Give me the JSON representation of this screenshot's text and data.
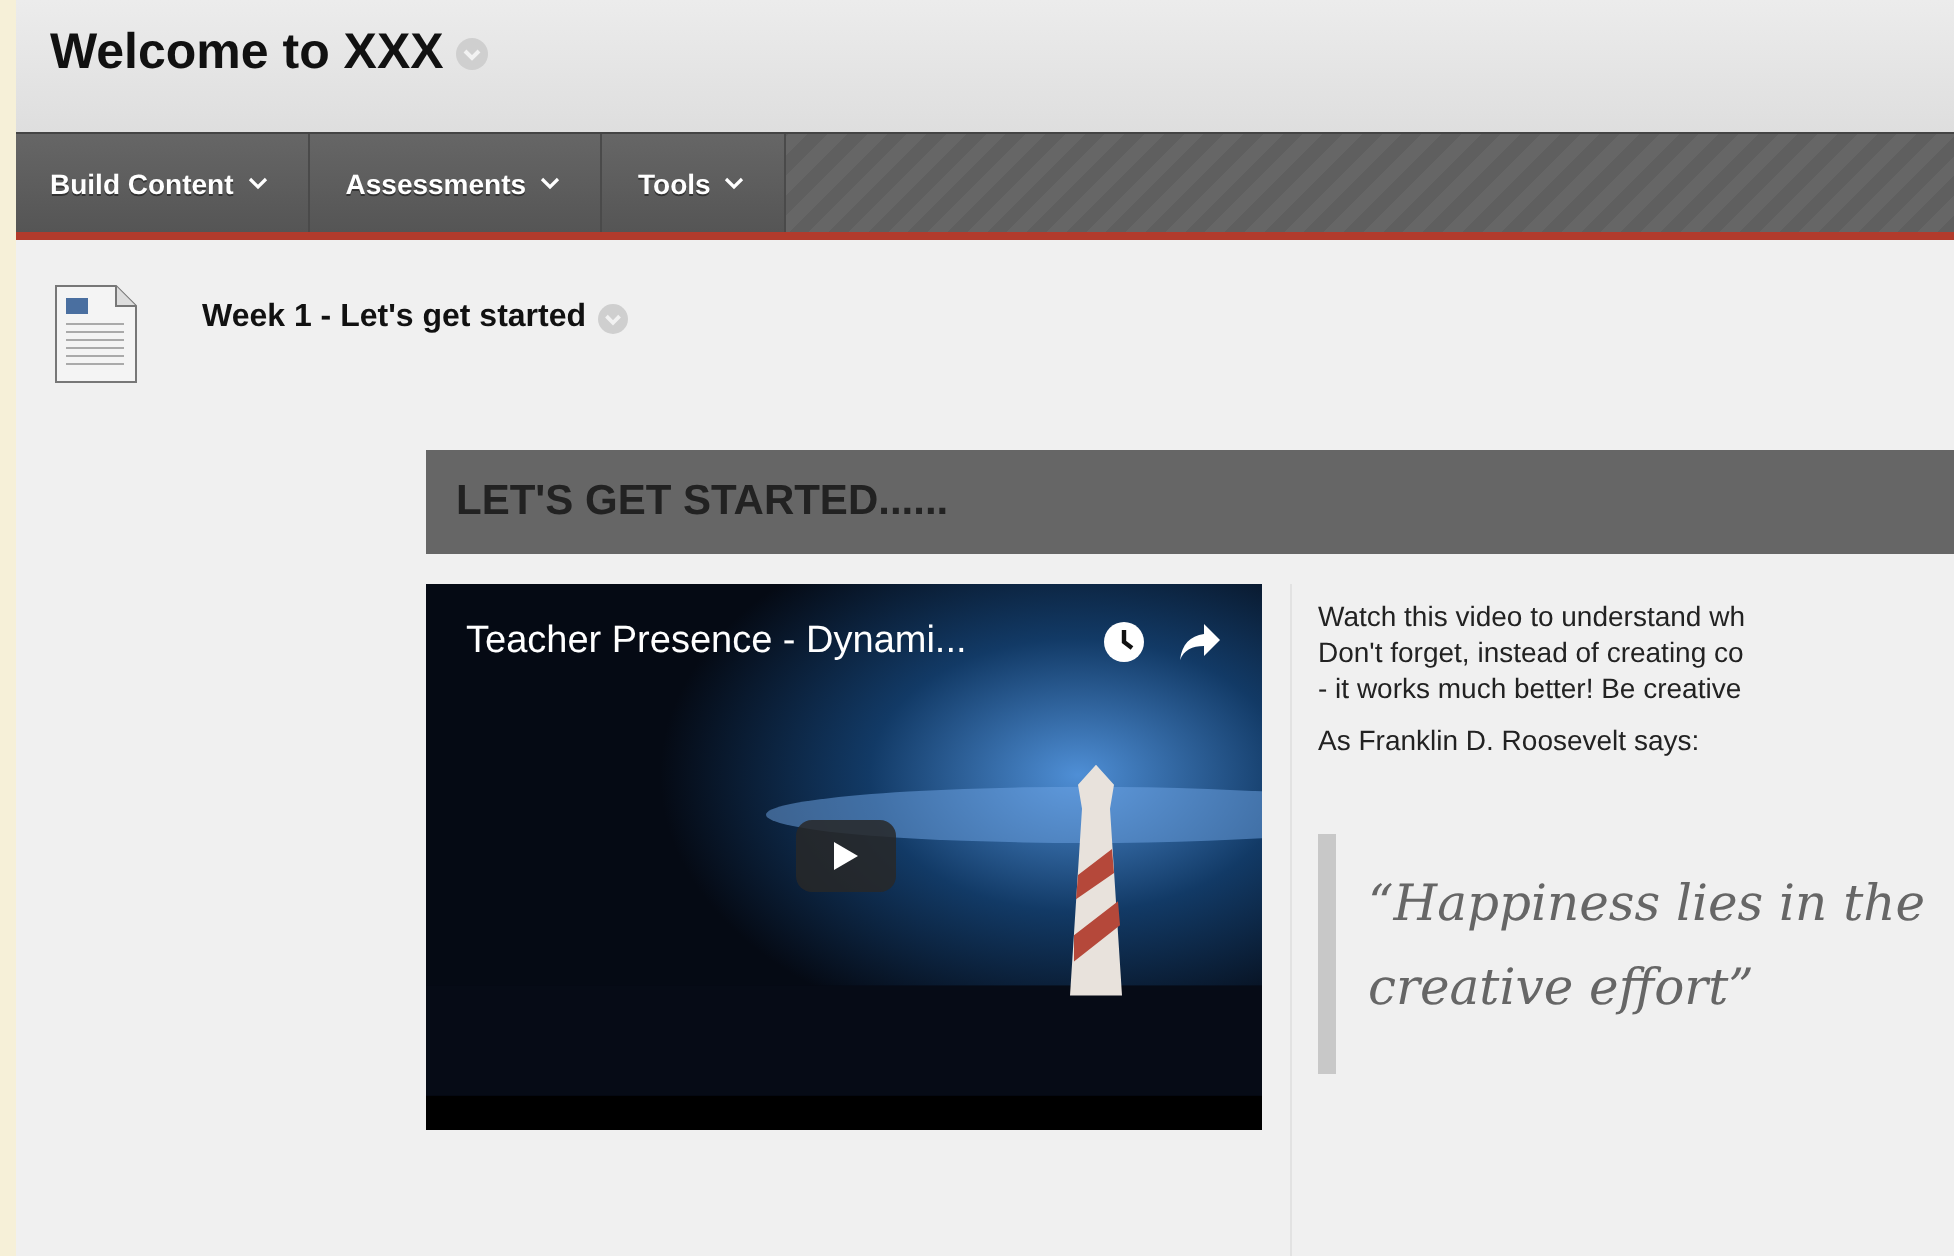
{
  "page_title": "Welcome to XXX",
  "menu": [
    {
      "label": "Build Content"
    },
    {
      "label": "Assessments"
    },
    {
      "label": "Tools"
    }
  ],
  "item": {
    "title": "Week 1 - Let's get started"
  },
  "banner": "LET'S GET STARTED......",
  "video": {
    "title": "Teacher Presence - Dynami...",
    "kind": "picture"
  },
  "paragraphs": [
    "Watch this video to understand wh\nDon't forget, instead of creating co\n- it works much better! Be creative",
    "As Franklin D. Roosevelt says:"
  ],
  "quote": "“Happiness lies in the\ncreative effort”"
}
